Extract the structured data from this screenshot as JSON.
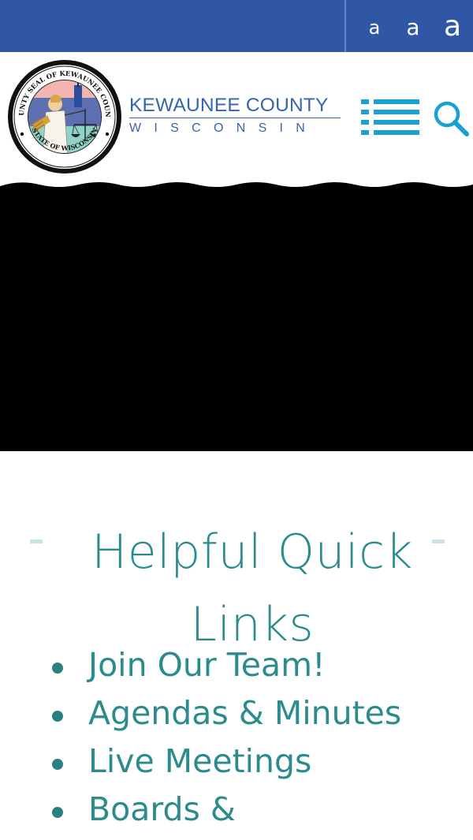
{
  "font_size_controls": {
    "small": "a",
    "medium": "a",
    "large": "a"
  },
  "header": {
    "seal": {
      "outer_text": "COUNTY SEAL OF KEWAUNEE COUNTY",
      "bottom_text": "STATE OF WISCONSIN"
    },
    "title": "KEWAUNEE COUNTY",
    "subtitle": "WISCONSIN",
    "menu_icon": "menu-icon",
    "search_icon": "search-icon"
  },
  "quick_links": {
    "heading": "Helpful Quick Links",
    "items": [
      {
        "label": "Join Our Team!"
      },
      {
        "label": "Agendas & Minutes"
      },
      {
        "label": "Live Meetings"
      },
      {
        "label": "Boards &"
      }
    ]
  },
  "colors": {
    "top_bar": "#3057a5",
    "brand_blue": "#3466ae",
    "icon_blue": "#1aa0d1",
    "teal_text": "#2c8b8c",
    "hero_background": "#000000"
  }
}
